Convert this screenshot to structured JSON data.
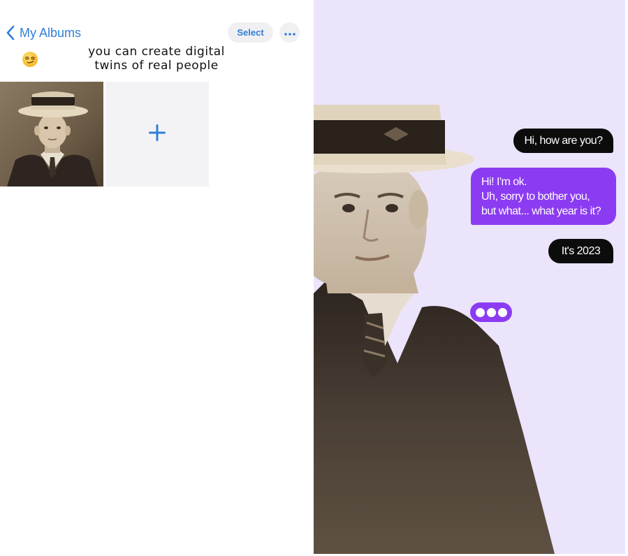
{
  "album_screen": {
    "nav": {
      "back_label": "My Albums",
      "select_label": "Select"
    },
    "caption_lines": [
      "you can create digital",
      "twins of real people"
    ],
    "emoji": "smirking-face",
    "icons": [
      "chevron-left-icon",
      "more-icon",
      "plus-icon"
    ]
  },
  "chat": {
    "messages": [
      {
        "role": "user",
        "text": "Hi, how are you?"
      },
      {
        "role": "twin",
        "lines": [
          "Hi! I'm ok.",
          "Uh, sorry to bother you,",
          "but what... what year is it?"
        ]
      },
      {
        "role": "user",
        "text": "It's 2023"
      }
    ],
    "typing_indicator": true
  },
  "colors": {
    "ios_blue": "#2f7fd6",
    "button_bg": "#f0f0f2",
    "chat_background": "#ebe4fb",
    "bubble_purple": "#8b3cf2",
    "bubble_black": "#0c0c0c",
    "sepia": "#6b5a46"
  }
}
